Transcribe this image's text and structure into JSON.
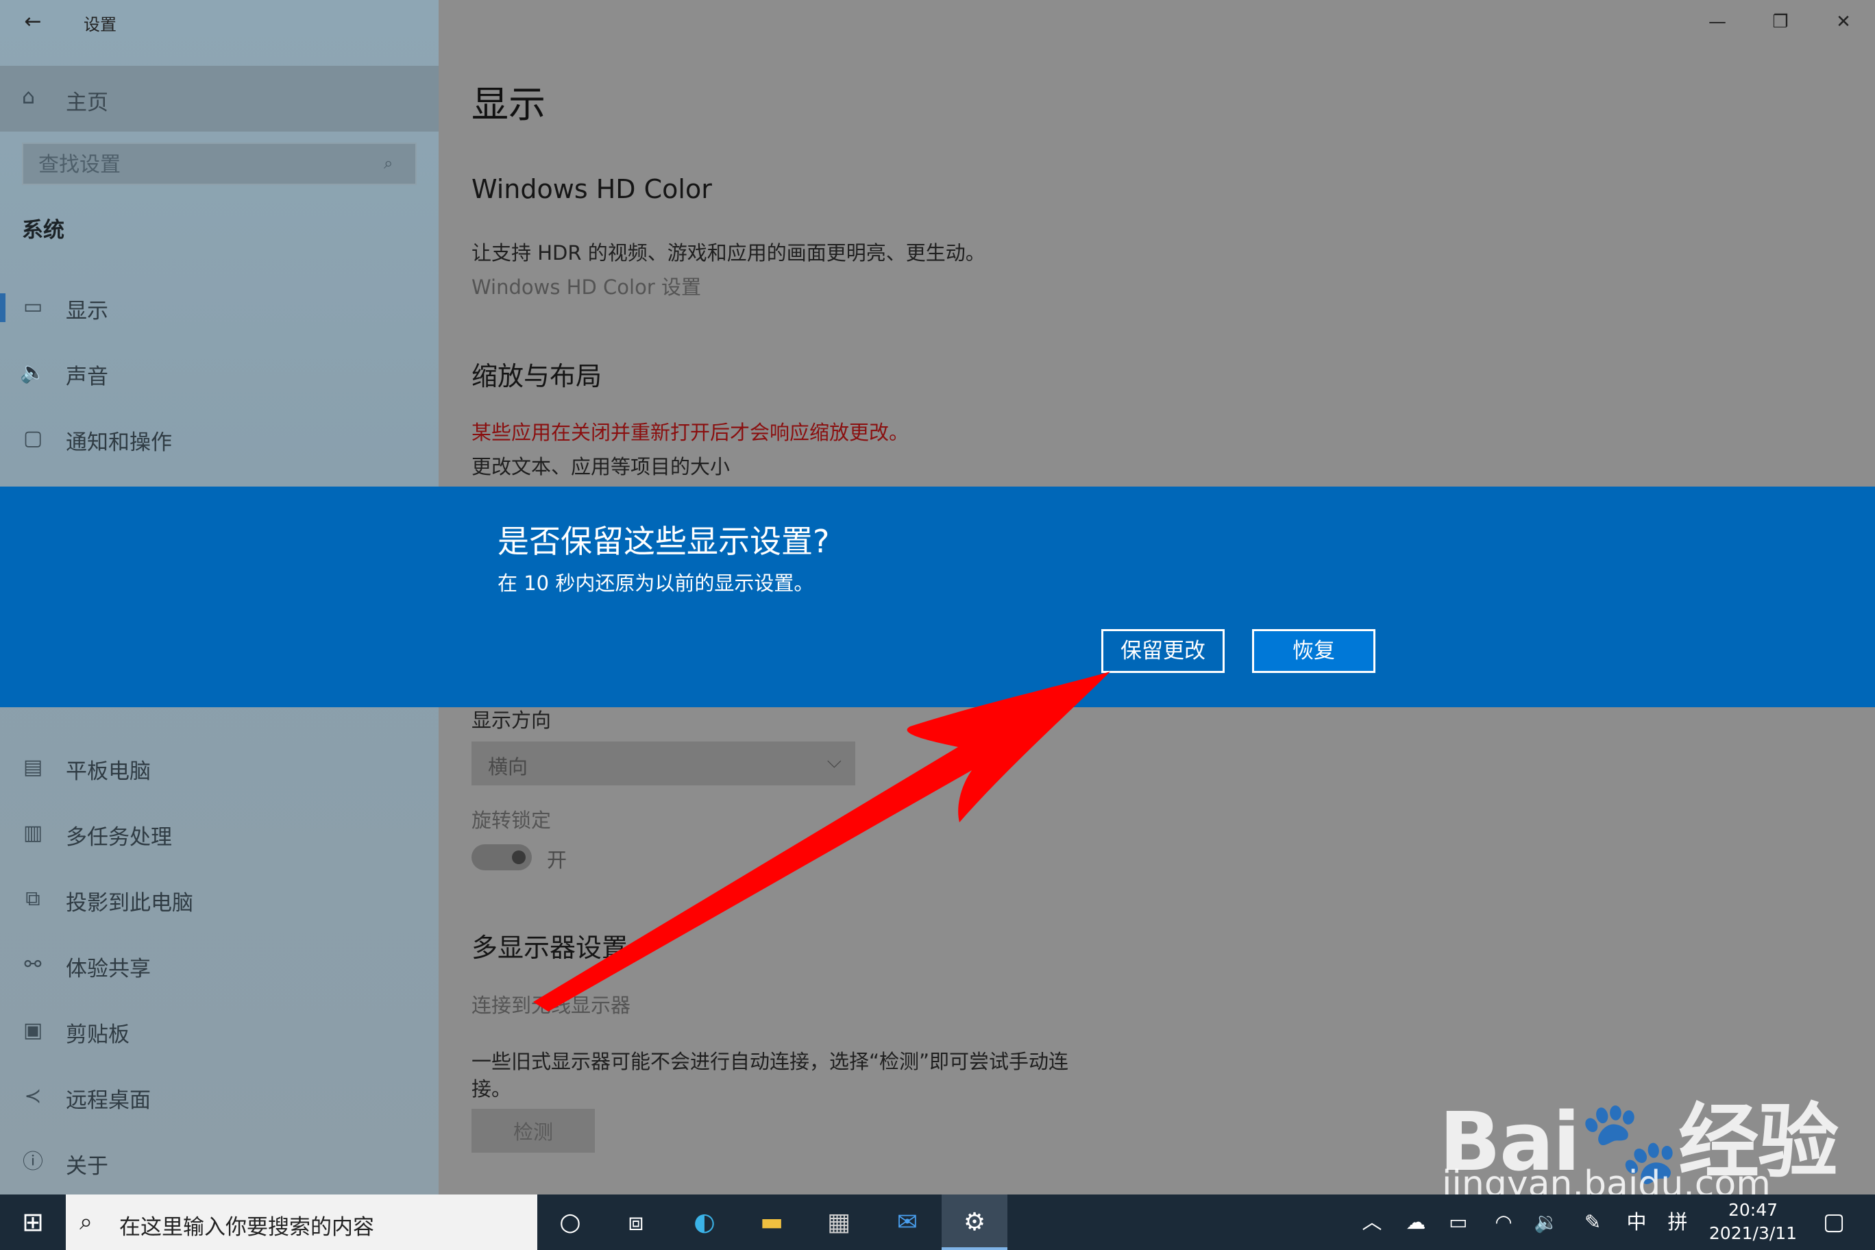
{
  "window": {
    "app_title": "设置",
    "back_glyph": "←",
    "minimize_glyph": "—",
    "maximize_glyph": "❐",
    "close_glyph": "✕"
  },
  "sidebar": {
    "home_label": "主页",
    "search_placeholder": "查找设置",
    "section": "系统",
    "items_top": [
      {
        "label": "显示",
        "icon": "monitor-icon",
        "glyph": "▭"
      },
      {
        "label": "声音",
        "icon": "speaker-icon",
        "glyph": "🔈"
      },
      {
        "label": "通知和操作",
        "icon": "notification-icon",
        "glyph": "▢"
      }
    ],
    "items_bottom": [
      {
        "label": "平板电脑",
        "icon": "tablet-icon",
        "glyph": "▤"
      },
      {
        "label": "多任务处理",
        "icon": "multitask-icon",
        "glyph": "▥"
      },
      {
        "label": "投影到此电脑",
        "icon": "project-icon",
        "glyph": "⧉"
      },
      {
        "label": "体验共享",
        "icon": "share-icon",
        "glyph": "⚯"
      },
      {
        "label": "剪贴板",
        "icon": "clipboard-icon",
        "glyph": "▣"
      },
      {
        "label": "远程桌面",
        "icon": "remote-icon",
        "glyph": "≺"
      },
      {
        "label": "关于",
        "icon": "info-icon",
        "glyph": "ⓘ"
      }
    ]
  },
  "main": {
    "title": "显示",
    "hd_color": {
      "heading": "Windows HD Color",
      "description": "让支持 HDR 的视频、游戏和应用的画面更明亮、更生动。",
      "link": "Windows HD Color 设置"
    },
    "scale": {
      "heading": "缩放与布局",
      "warning": "某些应用在关闭并重新打开后才会响应缩放更改。",
      "text_size_label": "更改文本、应用等项目的大小"
    },
    "orientation": {
      "label": "显示方向",
      "value": "横向"
    },
    "rotation_lock": {
      "label": "旋转锁定",
      "state": "开"
    },
    "multi_display": {
      "heading": "多显示器设置",
      "link": "连接到无线显示器",
      "description_line1": "一些旧式显示器可能不会进行自动连接，选择“检测”即可尝试手动连",
      "description_line2": "接。",
      "detect_button": "检测"
    }
  },
  "dialog": {
    "title": "是否保留这些显示设置?",
    "message": "在 10 秒内还原为以前的显示设置。",
    "keep_button": "保留更改",
    "revert_button": "恢复"
  },
  "watermark": {
    "brand": "Bai",
    "brand_suffix": "经验",
    "url": "jingyan.baidu.com"
  },
  "taskbar": {
    "search_placeholder": "在这里输入你要搜索的内容",
    "time": "20:47",
    "date": "2021/3/11",
    "ime_lang": "中",
    "ime_mode": "拼"
  },
  "colors": {
    "dialog_bg": "#0067b8",
    "warning_text": "#8a0f0f",
    "arrow": "#ff0000",
    "taskbar_bg": "#1b2a38"
  }
}
